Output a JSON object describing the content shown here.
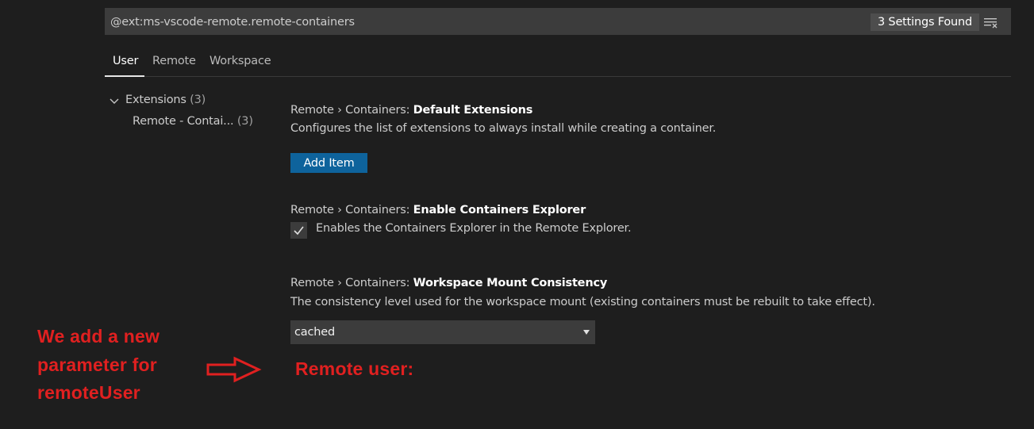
{
  "search": {
    "query": "@ext:ms-vscode-remote.remote-containers",
    "found_label": "3 Settings Found",
    "filter_icon": "clear-filter-icon"
  },
  "tabs": [
    {
      "label": "User",
      "active": true
    },
    {
      "label": "Remote",
      "active": false
    },
    {
      "label": "Workspace",
      "active": false
    }
  ],
  "tree": {
    "group_label": "Extensions",
    "group_count": "(3)",
    "item_label": "Remote - Contai...",
    "item_count": "(3)"
  },
  "settings": [
    {
      "prefix": "Remote › Containers: ",
      "key": "Default Extensions",
      "description": "Configures the list of extensions to always install while creating a container.",
      "button_label": "Add Item"
    },
    {
      "prefix": "Remote › Containers: ",
      "key": "Enable Containers Explorer",
      "checkbox_label": "Enables the Containers Explorer in the Remote Explorer.",
      "checked": true
    },
    {
      "prefix": "Remote › Containers: ",
      "key": "Workspace Mount Consistency",
      "description": "The consistency level used for the workspace mount (existing containers must be rebuilt to take effect).",
      "selected_value": "cached"
    }
  ],
  "annotation": {
    "line1": "We add a new",
    "line2": "parameter for",
    "line3": "remoteUser",
    "target_text": "Remote user:",
    "color": "#e02020"
  },
  "colors": {
    "background": "#1e1e1e",
    "input_background": "#3c3c3c",
    "button_background": "#0e639c"
  }
}
